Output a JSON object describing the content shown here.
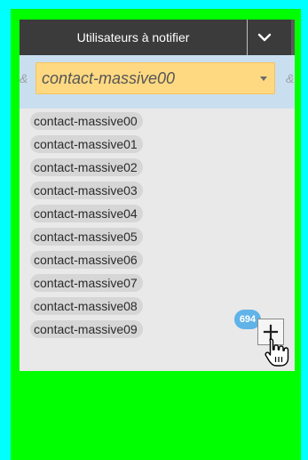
{
  "header": {
    "title": "Utilisateurs à notifier",
    "chevron_icon": "chevron-down-icon"
  },
  "filter": {
    "amp_left": "&",
    "amp_right": "&",
    "selected_value": "contact-massive00",
    "caret_icon": "caret-down-icon"
  },
  "tags": [
    {
      "label": "contact-massive00"
    },
    {
      "label": "contact-massive01"
    },
    {
      "label": "contact-massive02"
    },
    {
      "label": "contact-massive03"
    },
    {
      "label": "contact-massive04"
    },
    {
      "label": "contact-massive05"
    },
    {
      "label": "contact-massive06"
    },
    {
      "label": "contact-massive07"
    },
    {
      "label": "contact-massive08"
    },
    {
      "label": "contact-massive09"
    }
  ],
  "add": {
    "count_badge": "694",
    "icon": "plus-icon",
    "cursor_icon": "hand-pointer-icon"
  },
  "colors": {
    "background": "#00ff00",
    "frame": "#00ffff",
    "header_bg": "#3b3b3b",
    "filter_bg": "#c9dff0",
    "select_bg": "#ffd982",
    "badge_bg": "#5fb3e8"
  }
}
